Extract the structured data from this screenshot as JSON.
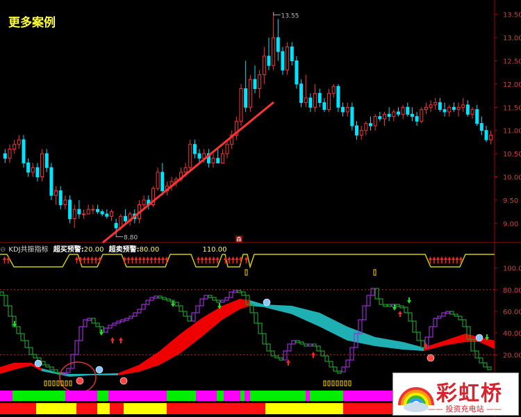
{
  "caption": "更多案例",
  "price_axis_labels": [
    "13.50",
    "13.00",
    "12.50",
    "12.00",
    "11.50",
    "11.00",
    "10.50",
    "10.00",
    "9.50",
    "9.00"
  ],
  "high_label": "13.55",
  "low_label": "8.80",
  "marker_char": "森",
  "indicator": {
    "name": "KDJ共振指标",
    "overbought_label": "超买预警:",
    "overbought_value": "20.00",
    "oversold_label": "超卖预警:",
    "oversold_value": "80.00",
    "current_value": "110.00"
  },
  "indicator_axis_labels": [
    "100.0",
    "80.00",
    "60.00",
    "40.00",
    "20.00"
  ],
  "logo": {
    "brand": "彩虹桥",
    "subtitle": "—— 投资充电站 ——"
  },
  "colors": {
    "up": "#ff3333",
    "down": "#00e5ff",
    "trend_line": "#ff3333",
    "ribbon_red": "#ee0000",
    "ribbon_teal": "#1fb0b3",
    "kline_green": "#1c9c2a",
    "kline_purple": "#9b2bd6",
    "magenta": "#ff00ff",
    "green_band": "#00ee00",
    "yellow_band": "#ffff00",
    "red_band": "#ff1111"
  },
  "chart_data": {
    "type": "candlestick",
    "y_range": [
      8.6,
      13.75
    ],
    "candles": [
      [
        10.5,
        10.6,
        10.3,
        10.4
      ],
      [
        10.4,
        10.7,
        10.3,
        10.6
      ],
      [
        10.6,
        10.8,
        10.5,
        10.7
      ],
      [
        10.7,
        10.9,
        10.6,
        10.8
      ],
      [
        10.8,
        10.9,
        10.2,
        10.3
      ],
      [
        10.3,
        10.4,
        10.0,
        10.1
      ],
      [
        10.1,
        10.3,
        10.0,
        10.2
      ],
      [
        10.2,
        10.3,
        9.9,
        10.0
      ],
      [
        10.0,
        10.6,
        9.9,
        10.5
      ],
      [
        10.5,
        10.6,
        10.1,
        10.2
      ],
      [
        10.2,
        10.3,
        9.5,
        9.6
      ],
      [
        9.6,
        9.8,
        9.4,
        9.7
      ],
      [
        9.7,
        9.8,
        9.3,
        9.4
      ],
      [
        9.4,
        9.6,
        9.3,
        9.5
      ],
      [
        9.5,
        9.6,
        9.0,
        9.1
      ],
      [
        9.1,
        9.4,
        8.9,
        9.3
      ],
      [
        9.3,
        9.5,
        9.1,
        9.2
      ],
      [
        9.2,
        9.3,
        9.1,
        9.2
      ],
      [
        9.2,
        9.4,
        9.2,
        9.3
      ],
      [
        9.3,
        9.4,
        9.2,
        9.3
      ],
      [
        9.3,
        9.4,
        9.2,
        9.25
      ],
      [
        9.25,
        9.3,
        9.15,
        9.2
      ],
      [
        9.2,
        9.3,
        9.1,
        9.15
      ],
      [
        9.15,
        9.3,
        9.05,
        9.25
      ],
      [
        9.0,
        9.1,
        8.8,
        8.9
      ],
      [
        8.9,
        9.2,
        8.85,
        9.15
      ],
      [
        9.15,
        9.3,
        9.0,
        9.05
      ],
      [
        9.05,
        9.25,
        8.95,
        9.2
      ],
      [
        9.2,
        9.3,
        9.0,
        9.1
      ],
      [
        9.1,
        9.5,
        9.0,
        9.4
      ],
      [
        9.4,
        9.6,
        9.3,
        9.5
      ],
      [
        9.5,
        9.6,
        9.3,
        9.4
      ],
      [
        9.4,
        9.8,
        9.35,
        9.75
      ],
      [
        9.75,
        10.2,
        9.7,
        10.1
      ],
      [
        10.1,
        10.3,
        9.6,
        9.7
      ],
      [
        9.7,
        9.9,
        9.6,
        9.8
      ],
      [
        9.8,
        10.0,
        9.7,
        9.9
      ],
      [
        9.9,
        10.0,
        9.8,
        9.95
      ],
      [
        9.95,
        10.2,
        9.9,
        10.1
      ],
      [
        10.1,
        10.3,
        10.0,
        10.2
      ],
      [
        10.2,
        10.8,
        10.1,
        10.7
      ],
      [
        10.7,
        10.8,
        10.4,
        10.5
      ],
      [
        10.5,
        10.6,
        10.3,
        10.4
      ],
      [
        10.4,
        10.6,
        10.3,
        10.5
      ],
      [
        10.5,
        10.6,
        10.2,
        10.3
      ],
      [
        10.3,
        10.5,
        10.2,
        10.4
      ],
      [
        10.4,
        10.6,
        10.3,
        10.3
      ],
      [
        10.3,
        10.6,
        10.3,
        10.5
      ],
      [
        10.5,
        10.8,
        10.4,
        10.7
      ],
      [
        10.7,
        11.0,
        10.6,
        10.9
      ],
      [
        10.9,
        11.3,
        10.8,
        11.2
      ],
      [
        11.2,
        12.0,
        11.1,
        11.9
      ],
      [
        11.9,
        12.5,
        11.4,
        11.5
      ],
      [
        11.5,
        12.2,
        11.4,
        12.1
      ],
      [
        12.1,
        12.4,
        11.8,
        11.9
      ],
      [
        11.9,
        12.3,
        11.7,
        12.2
      ],
      [
        12.2,
        12.8,
        12.0,
        12.6
      ],
      [
        12.6,
        13.0,
        12.3,
        12.4
      ],
      [
        12.4,
        13.55,
        12.3,
        13.0
      ],
      [
        13.0,
        13.4,
        12.5,
        12.7
      ],
      [
        12.7,
        12.8,
        12.2,
        12.3
      ],
      [
        12.3,
        12.9,
        12.2,
        12.8
      ],
      [
        12.8,
        12.9,
        12.4,
        12.5
      ],
      [
        12.5,
        12.6,
        11.9,
        12.0
      ],
      [
        12.0,
        12.1,
        11.5,
        11.6
      ],
      [
        11.6,
        12.2,
        11.5,
        11.7
      ],
      [
        11.7,
        11.8,
        11.4,
        11.5
      ],
      [
        11.5,
        12.0,
        11.4,
        11.8
      ],
      [
        11.8,
        11.9,
        11.5,
        11.6
      ],
      [
        11.6,
        11.7,
        11.4,
        11.45
      ],
      [
        11.45,
        11.9,
        11.4,
        11.8
      ],
      [
        11.8,
        12.0,
        11.7,
        11.95
      ],
      [
        11.95,
        12.0,
        11.4,
        11.5
      ],
      [
        11.5,
        11.6,
        11.3,
        11.4
      ],
      [
        11.4,
        11.6,
        11.3,
        11.5
      ],
      [
        11.5,
        11.6,
        11.0,
        11.1
      ],
      [
        11.1,
        11.2,
        10.8,
        10.9
      ],
      [
        10.9,
        11.1,
        10.8,
        11.0
      ],
      [
        11.0,
        11.2,
        10.9,
        11.15
      ],
      [
        11.15,
        11.3,
        11.0,
        11.1
      ],
      [
        11.1,
        11.35,
        11.0,
        11.3
      ],
      [
        11.3,
        11.4,
        11.2,
        11.25
      ],
      [
        11.25,
        11.4,
        11.1,
        11.35
      ],
      [
        11.35,
        11.5,
        11.2,
        11.3
      ],
      [
        11.3,
        11.45,
        11.2,
        11.4
      ],
      [
        11.4,
        11.5,
        11.3,
        11.35
      ],
      [
        11.35,
        11.55,
        11.25,
        11.5
      ],
      [
        11.5,
        11.6,
        11.3,
        11.35
      ],
      [
        11.35,
        11.5,
        11.2,
        11.3
      ],
      [
        11.3,
        11.4,
        11.1,
        11.2
      ],
      [
        11.2,
        11.5,
        11.15,
        11.45
      ],
      [
        11.45,
        11.6,
        11.35,
        11.5
      ],
      [
        11.5,
        11.65,
        11.4,
        11.55
      ],
      [
        11.55,
        11.7,
        11.45,
        11.6
      ],
      [
        11.6,
        11.7,
        11.4,
        11.45
      ],
      [
        11.45,
        11.6,
        11.3,
        11.4
      ],
      [
        11.4,
        11.55,
        11.3,
        11.5
      ],
      [
        11.5,
        11.6,
        11.4,
        11.45
      ],
      [
        11.45,
        11.6,
        11.3,
        11.5
      ],
      [
        11.5,
        11.7,
        11.4,
        11.55
      ],
      [
        11.55,
        11.65,
        11.3,
        11.35
      ],
      [
        11.35,
        11.5,
        11.25,
        11.45
      ],
      [
        11.45,
        11.55,
        11.1,
        11.15
      ],
      [
        11.15,
        11.3,
        10.9,
        11.0
      ],
      [
        11.0,
        11.1,
        10.75,
        10.8
      ],
      [
        10.8,
        11.0,
        10.7,
        10.9
      ]
    ]
  }
}
